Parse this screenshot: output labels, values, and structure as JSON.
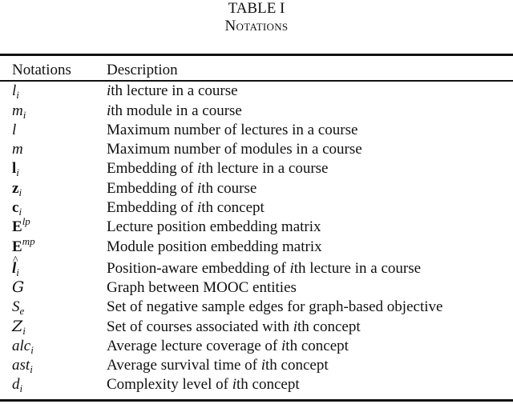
{
  "caption": {
    "label": "TABLE I",
    "title": "Notations"
  },
  "table": {
    "columns": [
      "Notations",
      "Description"
    ],
    "rows": [
      {
        "symbol": "l",
        "sub": "i",
        "sup": "",
        "style": "math",
        "desc_pre": "",
        "desc_i": "i",
        "desc_post": "th lecture in a course"
      },
      {
        "symbol": "m",
        "sub": "i",
        "sup": "",
        "style": "math",
        "desc_pre": "",
        "desc_i": "i",
        "desc_post": "th module in a course"
      },
      {
        "symbol": "l",
        "sub": "",
        "sup": "",
        "style": "math",
        "desc_pre": "Maximum number of lectures in a course",
        "desc_i": "",
        "desc_post": ""
      },
      {
        "symbol": "m",
        "sub": "",
        "sup": "",
        "style": "math",
        "desc_pre": "Maximum number of modules in a course",
        "desc_i": "",
        "desc_post": ""
      },
      {
        "symbol": "l",
        "sub": "i",
        "sup": "",
        "style": "bold",
        "desc_pre": "Embedding of ",
        "desc_i": "i",
        "desc_post": "th lecture in a course"
      },
      {
        "symbol": "z",
        "sub": "i",
        "sup": "",
        "style": "bold",
        "desc_pre": "Embedding of ",
        "desc_i": "i",
        "desc_post": "th course"
      },
      {
        "symbol": "c",
        "sub": "i",
        "sup": "",
        "style": "bold",
        "desc_pre": "Embedding of ",
        "desc_i": "i",
        "desc_post": "th concept"
      },
      {
        "symbol": "E",
        "sub": "",
        "sup": "lp",
        "style": "bold",
        "desc_pre": "Lecture position embedding matrix",
        "desc_i": "",
        "desc_post": ""
      },
      {
        "symbol": "E",
        "sub": "",
        "sup": "mp",
        "style": "bold",
        "desc_pre": "Module position embedding matrix",
        "desc_i": "",
        "desc_post": ""
      },
      {
        "symbol": "l",
        "sub": "i",
        "sup": "",
        "style": "bolditalic-hat",
        "desc_pre": "Position-aware embedding of ",
        "desc_i": "i",
        "desc_post": "th lecture in a course"
      },
      {
        "symbol": "G",
        "sub": "",
        "sup": "",
        "style": "cal",
        "desc_pre": "Graph between MOOC entities",
        "desc_i": "",
        "desc_post": ""
      },
      {
        "symbol": "S",
        "sub": "e",
        "sup": "",
        "style": "math",
        "desc_pre": "Set of negative sample edges for graph-based objective",
        "desc_i": "",
        "desc_post": ""
      },
      {
        "symbol": "Z",
        "sub": "i",
        "sup": "",
        "style": "cal",
        "desc_pre": "Set of courses associated with ",
        "desc_i": "i",
        "desc_post": "th concept"
      },
      {
        "symbol": "alc",
        "sub": "i",
        "sup": "",
        "style": "math",
        "desc_pre": "Average lecture coverage of ",
        "desc_i": "i",
        "desc_post": "th concept"
      },
      {
        "symbol": "ast",
        "sub": "i",
        "sup": "",
        "style": "math",
        "desc_pre": "Average survival time of ",
        "desc_i": "i",
        "desc_post": "th concept"
      },
      {
        "symbol": "d",
        "sub": "i",
        "sup": "",
        "style": "math",
        "desc_pre": "Complexity level of ",
        "desc_i": "i",
        "desc_post": "th concept"
      }
    ]
  }
}
